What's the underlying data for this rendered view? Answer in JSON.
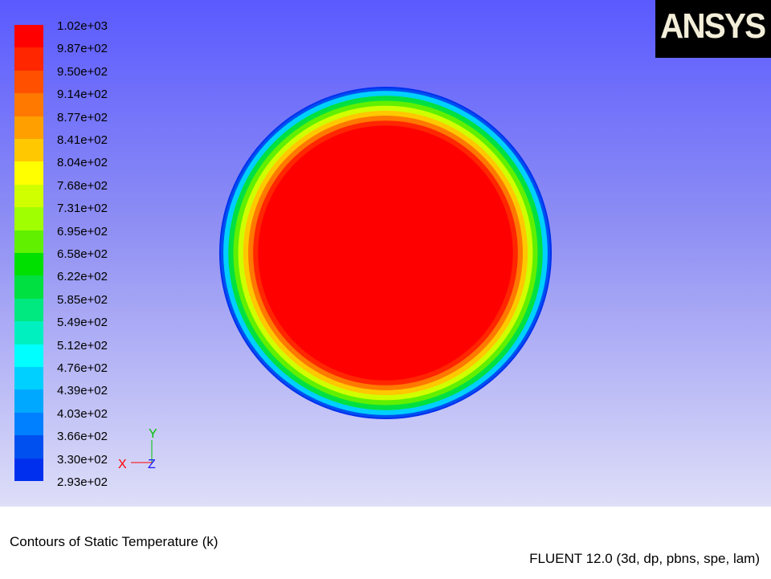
{
  "logo": {
    "text": "ANSYS",
    "mark": "®"
  },
  "footer": {
    "title": "Contours of Static Temperature (k)",
    "solver": "FLUENT 12.0 (3d, dp, pbns, spe, lam)"
  },
  "triad": {
    "y_label": "Y",
    "x_label": "X",
    "z_label": "Z"
  },
  "chart_data": {
    "type": "heatmap",
    "title": "Contours of Static Temperature (k)",
    "colorbar": {
      "tick_labels": [
        "1.02e+03",
        "9.87e+02",
        "9.50e+02",
        "9.14e+02",
        "8.77e+02",
        "8.41e+02",
        "8.04e+02",
        "7.68e+02",
        "7.31e+02",
        "6.95e+02",
        "6.58e+02",
        "6.22e+02",
        "5.85e+02",
        "5.49e+02",
        "5.12e+02",
        "4.76e+02",
        "4.39e+02",
        "4.03e+02",
        "3.66e+02",
        "3.30e+02",
        "2.93e+02"
      ],
      "min": 293,
      "max": 1020,
      "colors": [
        "#ff0000",
        "#ff2600",
        "#ff5000",
        "#ff7800",
        "#ffa000",
        "#ffc800",
        "#ffff00",
        "#d0ff00",
        "#a0ff00",
        "#60f000",
        "#00e000",
        "#00e040",
        "#00e880",
        "#00f0c0",
        "#00ffff",
        "#00d0ff",
        "#00a8ff",
        "#0080ff",
        "#0050f0",
        "#0030ee"
      ]
    },
    "domain": "circular cross-section; hot core at max temperature, decreasing radially to minimum at the wall",
    "radial_profile": {
      "note": "temperature vs normalized radius r/R",
      "r": [
        0.0,
        0.77,
        0.8,
        0.83,
        0.86,
        0.89,
        0.92,
        0.95,
        0.98,
        1.0
      ],
      "T": [
        1020,
        1020,
        950,
        877,
        804,
        731,
        658,
        585,
        440,
        330
      ]
    }
  }
}
